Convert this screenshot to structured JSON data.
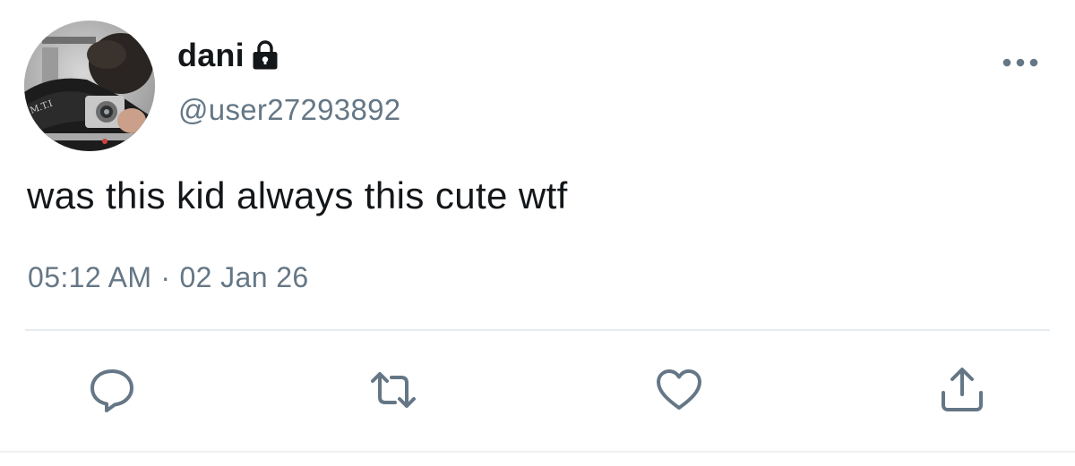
{
  "tweet": {
    "display_name": "dani",
    "handle": "@user27293892",
    "text": "was this kid always this cute wtf",
    "time": "05:12 AM",
    "separator": "·",
    "date": "02 Jan 26",
    "protected_icon": "lock-icon",
    "avatar_description": "avatar"
  },
  "actions": {
    "reply_icon": "reply-icon",
    "retweet_icon": "retweet-icon",
    "like_icon": "heart-icon",
    "share_icon": "share-icon",
    "more_icon": "more-icon"
  },
  "colors": {
    "text_primary": "#14171a",
    "text_secondary": "#657786",
    "icon": "#657786",
    "divider": "#e6ecf0"
  }
}
